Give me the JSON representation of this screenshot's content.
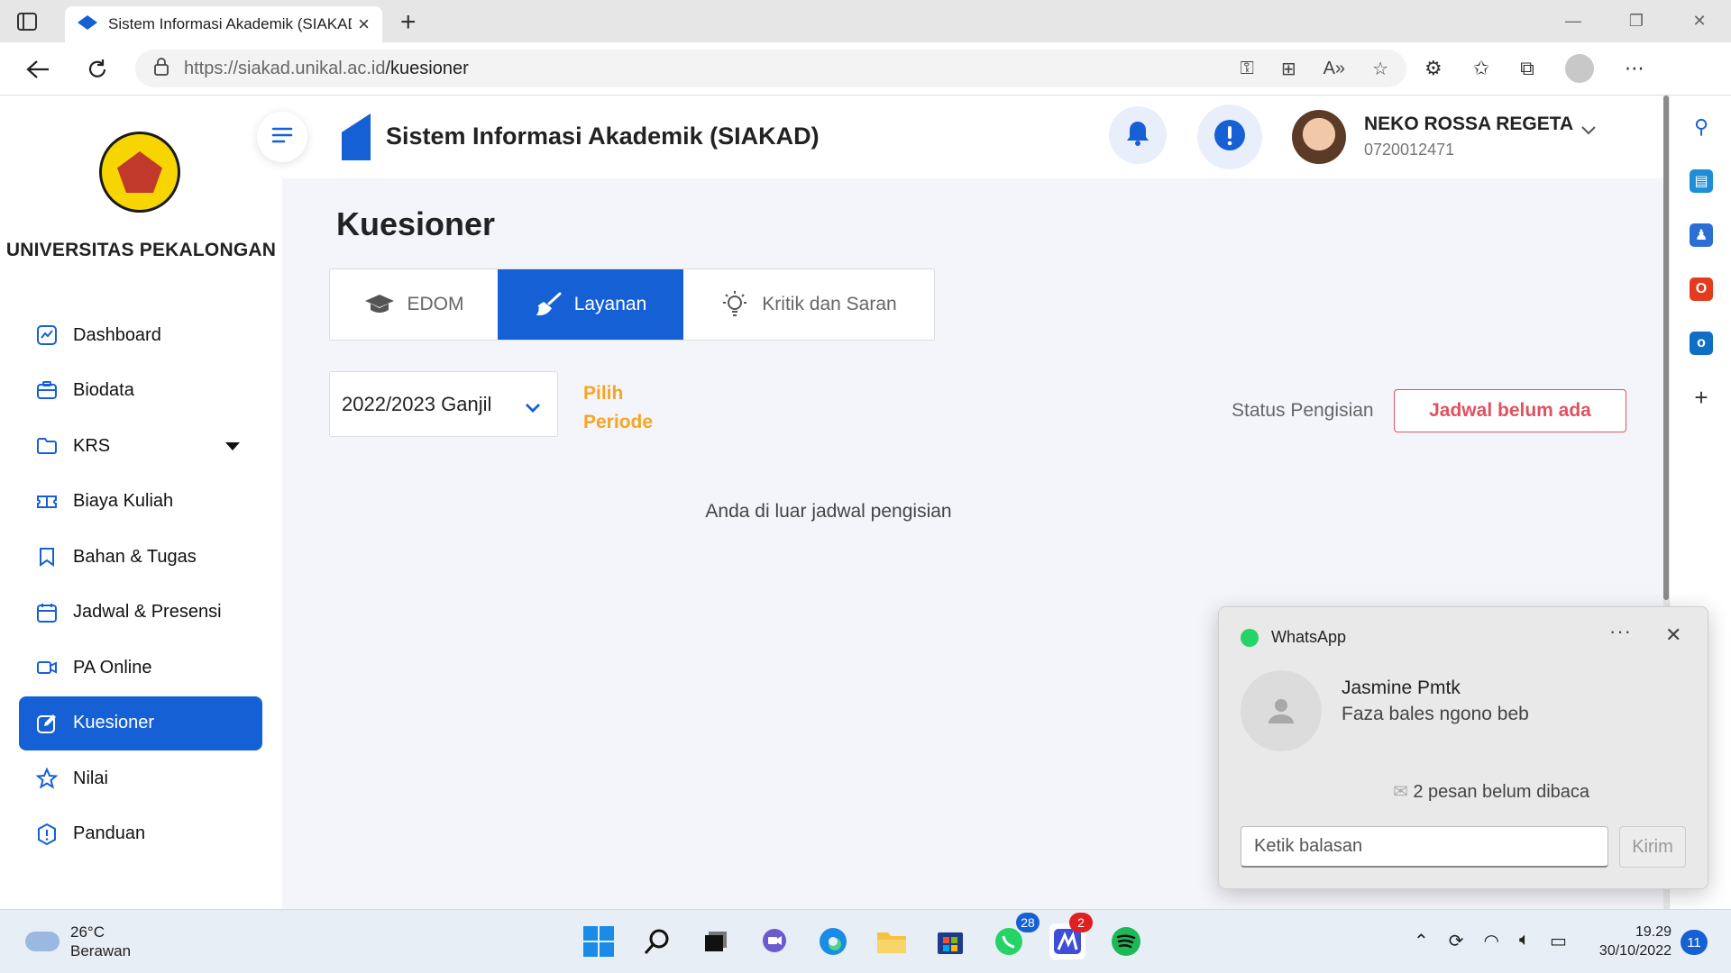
{
  "browser": {
    "tab_title": "Sistem Informasi Akademik (SIAKAD)",
    "url_host": "https://siakad.unikal.ac.id",
    "url_path": "/kuesioner"
  },
  "sidebar": {
    "university_name": "UNIVERSITAS PEKALONGAN",
    "items": [
      {
        "label": "Dashboard",
        "icon": "chart-icon"
      },
      {
        "label": "Biodata",
        "icon": "id-card-icon"
      },
      {
        "label": "KRS",
        "icon": "folder-icon",
        "has_submenu": true
      },
      {
        "label": "Biaya Kuliah",
        "icon": "ticket-icon"
      },
      {
        "label": "Bahan & Tugas",
        "icon": "bookmark-icon"
      },
      {
        "label": "Jadwal & Presensi",
        "icon": "calendar-icon"
      },
      {
        "label": "PA Online",
        "icon": "video-icon"
      },
      {
        "label": "Kuesioner",
        "icon": "edit-icon",
        "active": true
      },
      {
        "label": "Nilai",
        "icon": "star-icon"
      },
      {
        "label": "Panduan",
        "icon": "info-icon"
      }
    ]
  },
  "header": {
    "app_title": "Sistem Informasi Akademik (SIAKAD)",
    "user_name": "NEKO ROSSA REGETA",
    "user_id": "0720012471"
  },
  "main": {
    "page_title": "Kuesioner",
    "tabs": [
      {
        "label": "EDOM",
        "icon": "graduation-cap-icon"
      },
      {
        "label": "Layanan",
        "icon": "broom-icon",
        "active": true
      },
      {
        "label": "Kritik dan Saran",
        "icon": "lightbulb-icon"
      }
    ],
    "period_selected": "2022/2023 Ganjil",
    "period_hint": "Pilih Periode",
    "status_label": "Status Pengisian",
    "status_value": "Jadwal belum ada",
    "empty_message": "Anda di luar jadwal pengisian"
  },
  "notification": {
    "app": "WhatsApp",
    "sender": "Jasmine Pmtk",
    "message": "Faza bales ngono beb",
    "unread_text": "2 pesan belum dibaca",
    "reply_placeholder": "Ketik balasan",
    "send_label": "Kirim"
  },
  "taskbar": {
    "weather_temp": "26°C",
    "weather_desc": "Berawan",
    "whatsapp_badge": "28",
    "app_badge": "2",
    "time": "19.29",
    "date": "30/10/2022",
    "notification_count": "11"
  },
  "colors": {
    "primary": "#1660d6",
    "accent_orange": "#f5a623",
    "status_red": "#e0515f"
  }
}
